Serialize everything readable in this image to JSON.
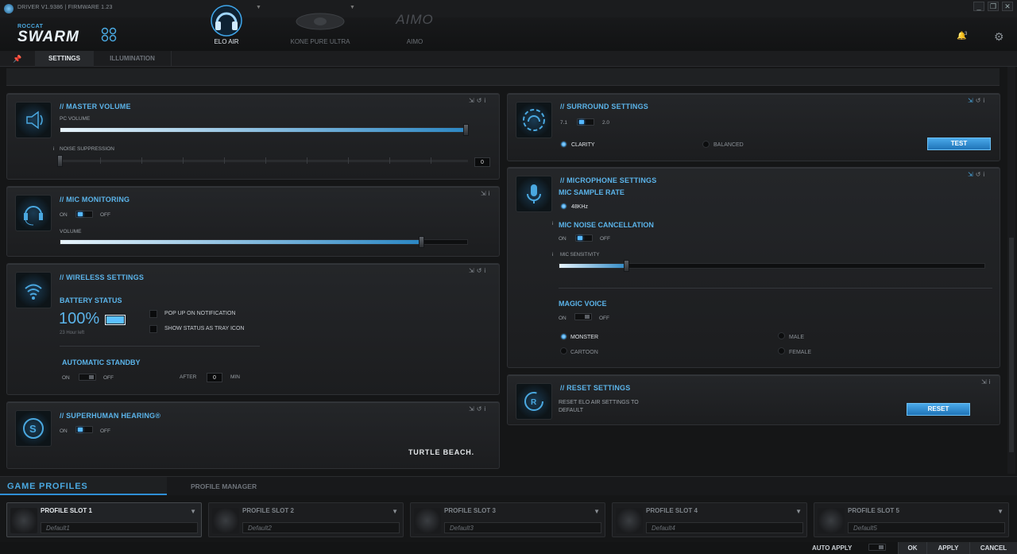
{
  "titlebar": {
    "version": "DRIVER V1.9386 | FIRMWARE 1.23"
  },
  "logo": {
    "sub": "ROCCAT",
    "main": "SWARM"
  },
  "devices": [
    {
      "label": "ELO AIR"
    },
    {
      "label": "KONE PURE ULTRA"
    },
    {
      "label": "AIMO"
    }
  ],
  "header": {
    "notification_count": "3"
  },
  "tabs": [
    "SETTINGS",
    "ILLUMINATION"
  ],
  "master_volume": {
    "title": "MASTER VOLUME",
    "pc_volume_label": "PC VOLUME",
    "pc_volume": 1.0,
    "noise_label": "NOISE SUPPRESSION",
    "noise_value": "0"
  },
  "mic_monitoring": {
    "title": "MIC MONITORING",
    "on": "ON",
    "off": "OFF",
    "volume_label": "VOLUME",
    "volume": 0.88
  },
  "wireless": {
    "title": "WIRELESS SETTINGS",
    "battery_status": "BATTERY STATUS",
    "battery": "100%",
    "hours_left": "23 Hour left",
    "popup": "POP UP ON NOTIFICATION",
    "tray": "SHOW STATUS AS TRAY ICON",
    "standby_title": "AUTOMATIC STANDBY",
    "on": "ON",
    "off": "OFF",
    "after": "AFTER",
    "after_value": "0",
    "min": "MIN"
  },
  "superhuman": {
    "title": "SUPERHUMAN HEARING®",
    "on": "ON",
    "off": "OFF",
    "brand": "TURTLE BEACH."
  },
  "surround": {
    "title": "SURROUND SETTINGS",
    "opt_a": "7.1",
    "opt_b": "2.0",
    "clarity": "CLARITY",
    "balanced": "BALANCED",
    "test": "TEST"
  },
  "microphone": {
    "title": "MICROPHONE SETTINGS",
    "sample_rate_title": "MIC SAMPLE RATE",
    "sample_rate": "48KHz",
    "noise_title": "MIC NOISE CANCELLATION",
    "on": "ON",
    "off": "OFF",
    "sensitivity_label": "MIC SENSITIVITY",
    "sensitivity": 0.16,
    "magic_title": "MAGIC VOICE",
    "monster": "MONSTER",
    "male": "MALE",
    "cartoon": "CARTOON",
    "female": "FEMALE"
  },
  "reset": {
    "title": "RESET SETTINGS",
    "text1": "RESET ELO AIR SETTINGS TO",
    "text2": "DEFAULT",
    "button": "RESET"
  },
  "bottom": {
    "game_profiles": "GAME PROFILES",
    "profile_manager": "PROFILE MANAGER",
    "slots": [
      {
        "name": "PROFILE SLOT 1",
        "profile": "Default1"
      },
      {
        "name": "PROFILE SLOT 2",
        "profile": "Default2"
      },
      {
        "name": "PROFILE SLOT 3",
        "profile": "Default3"
      },
      {
        "name": "PROFILE SLOT 4",
        "profile": "Default4"
      },
      {
        "name": "PROFILE SLOT 5",
        "profile": "Default5"
      }
    ],
    "auto_apply": "AUTO APPLY",
    "ok": "OK",
    "apply": "APPLY",
    "cancel": "CANCEL"
  },
  "colors": {
    "accent": "#5bb4ea",
    "button": "#2f8fd6"
  }
}
